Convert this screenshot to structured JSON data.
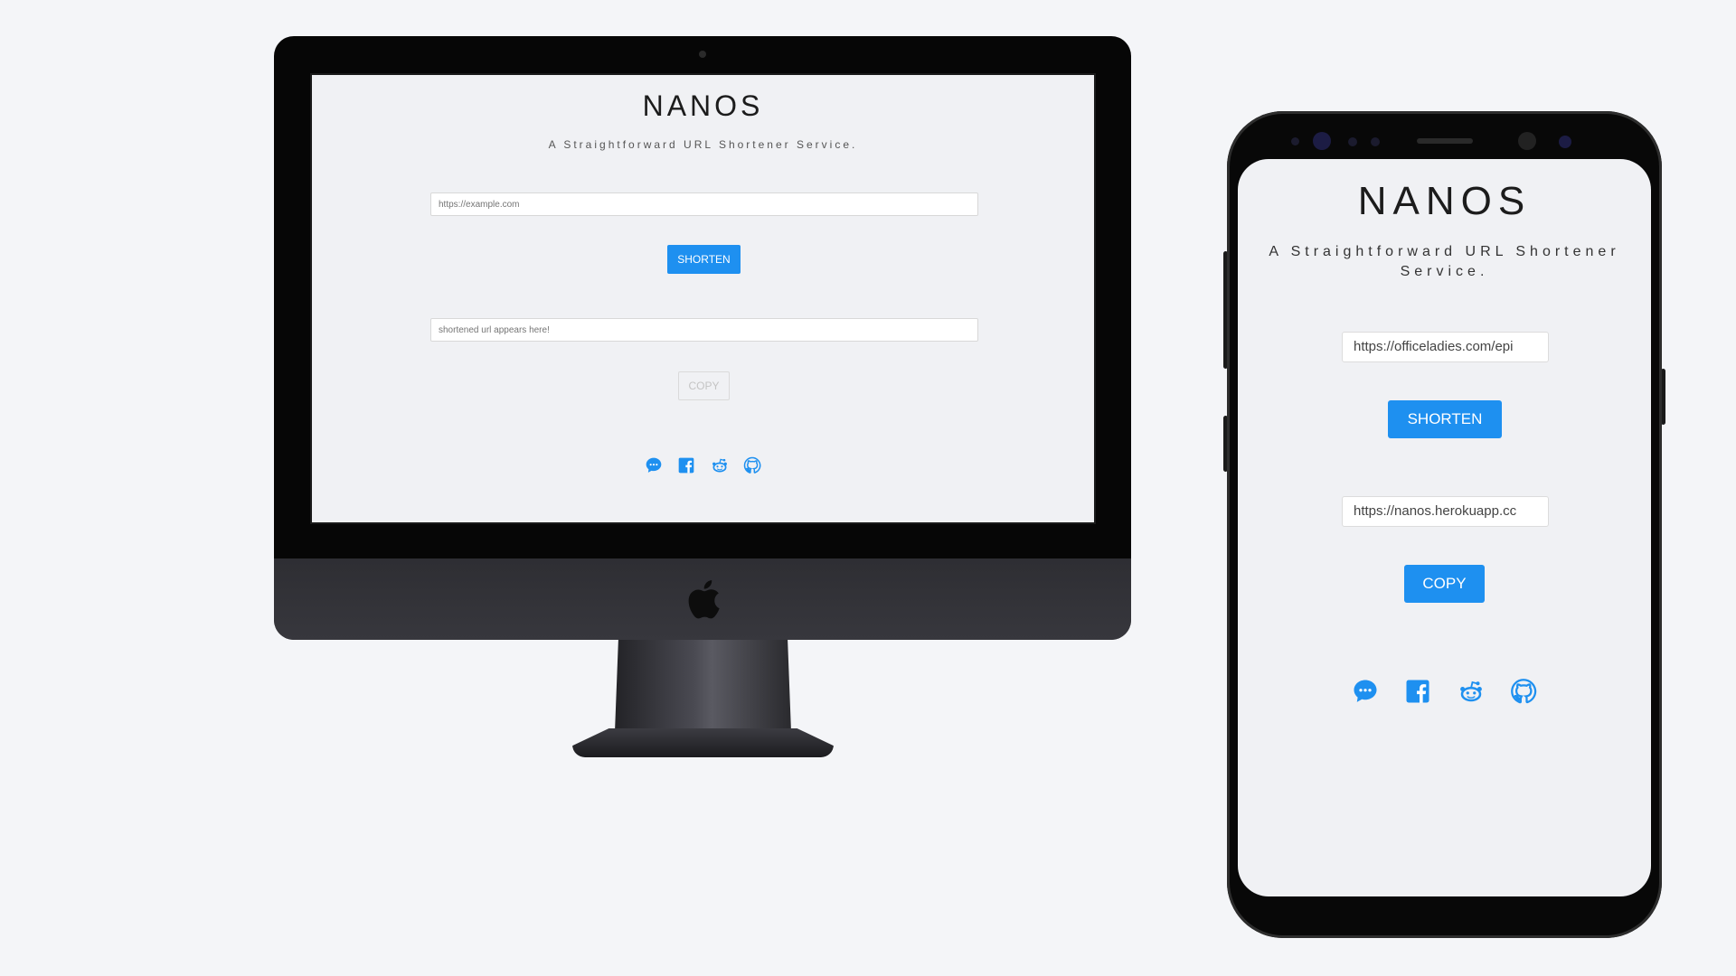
{
  "desktop": {
    "title": "NANOS",
    "subtitle": "A Straightforward URL Shortener Service.",
    "url_input": {
      "placeholder": "https://example.com",
      "value": ""
    },
    "shorten_label": "SHORTEN",
    "output_input": {
      "placeholder": "shortened url appears here!",
      "value": ""
    },
    "copy_label": "COPY",
    "icons": [
      "chat-icon",
      "facebook-icon",
      "reddit-icon",
      "github-icon"
    ]
  },
  "mobile": {
    "title": "NANOS",
    "subtitle": "A Straightforward URL Shortener Service.",
    "url_input": {
      "value": "https://officeladies.com/epi"
    },
    "shorten_label": "SHORTEN",
    "output_input": {
      "value": "https://nanos.herokuapp.cc"
    },
    "copy_label": "COPY",
    "icons": [
      "chat-icon",
      "facebook-icon",
      "reddit-icon",
      "github-icon"
    ]
  },
  "colors": {
    "accent": "#1e90f0",
    "background": "#f4f5f8",
    "screen": "#f0f1f4"
  }
}
